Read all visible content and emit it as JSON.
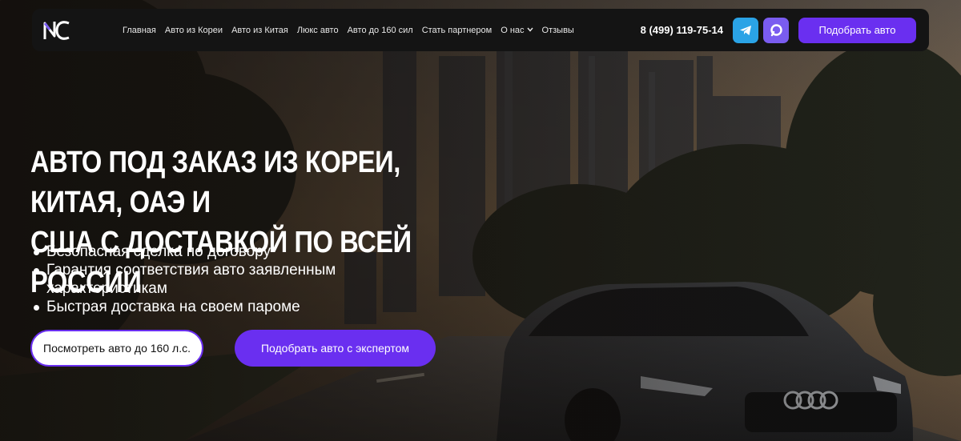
{
  "colors": {
    "accent": "#6a2ff0",
    "navbar": "#141414",
    "telegram": "#2aa3e6",
    "max": "#7a5cf0"
  },
  "header": {
    "logo_icon": "nc-logo",
    "nav": [
      {
        "label": "Главная"
      },
      {
        "label": "Авто из Кореи"
      },
      {
        "label": "Авто из Китая"
      },
      {
        "label": "Люкс авто"
      },
      {
        "label": "Авто до 160 сил"
      },
      {
        "label": "Стать партнером"
      },
      {
        "label": "О нас",
        "icon": "chevron-down-icon"
      },
      {
        "label": "Отзывы"
      }
    ],
    "phone": "8 (499) 119-75-14",
    "social": [
      {
        "icon": "telegram-icon"
      },
      {
        "icon": "max-messenger-icon"
      }
    ],
    "cta_label": "Подобрать авто"
  },
  "hero": {
    "title_line1": "Авто под заказ из Кореи, Китая, ОАЭ и",
    "title_line2": "США с доставкой по всей России",
    "bullets": [
      "Безопасная сделка по договору",
      "Гарантия соответствия авто заявленным характеристикам",
      "Быстрая доставка на своем пароме"
    ],
    "btn_view_160": "Посмотреть авто до 160 л.с.",
    "btn_expert": "Подобрать авто с экспертом"
  }
}
